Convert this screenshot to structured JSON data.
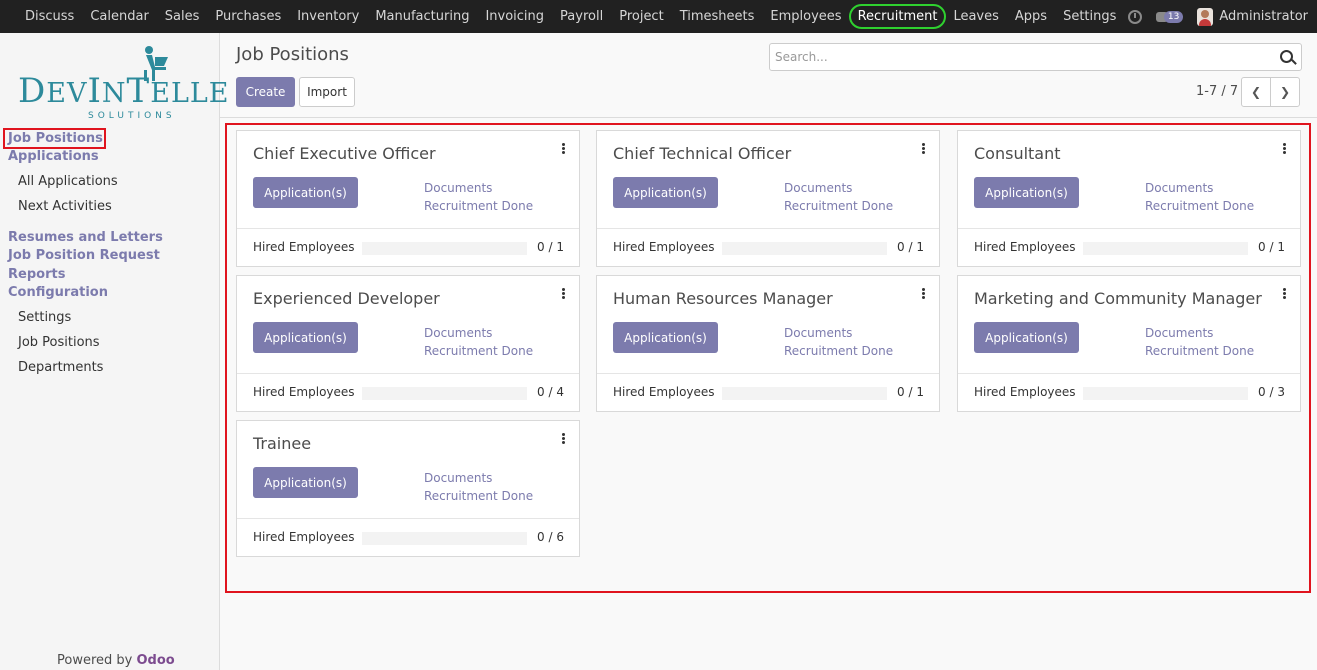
{
  "topbar": {
    "menu": [
      "Discuss",
      "Calendar",
      "Sales",
      "Purchases",
      "Inventory",
      "Manufacturing",
      "Invoicing",
      "Payroll",
      "Project",
      "Timesheets",
      "Employees",
      "Recruitment",
      "Leaves",
      "Apps",
      "Settings"
    ],
    "active": "Recruitment",
    "messages_count": "13",
    "user": "Administrator"
  },
  "sidebar": {
    "logo": {
      "text_big": "D",
      "text_rest": "EV",
      "text_big2": "I",
      "text_rest2": "N",
      "text3": "T",
      "text4": "ELLE",
      "sub": "SOLUTIONS"
    },
    "items": [
      {
        "label": "Job Positions",
        "type": "head"
      },
      {
        "label": "Applications",
        "type": "head"
      },
      {
        "label": "All Applications",
        "type": "sub"
      },
      {
        "label": "Next Activities",
        "type": "sub"
      },
      {
        "label": "Resumes and Letters",
        "type": "head"
      },
      {
        "label": "Job Position Request",
        "type": "head"
      },
      {
        "label": "Reports",
        "type": "head"
      },
      {
        "label": "Configuration",
        "type": "head"
      },
      {
        "label": "Settings",
        "type": "sub"
      },
      {
        "label": "Job Positions",
        "type": "sub"
      },
      {
        "label": "Departments",
        "type": "sub"
      }
    ],
    "powered_prefix": "Powered by ",
    "powered_brand": "Odoo"
  },
  "control": {
    "title": "Job Positions",
    "create_label": "Create",
    "import_label": "Import",
    "search_placeholder": "Search...",
    "pager": "1-7 / 7"
  },
  "cards": [
    {
      "title": "Chief Executive Officer",
      "button": "Application(s)",
      "link1": "Documents",
      "link2": "Recruitment Done",
      "footer_label": "Hired Employees",
      "hired": 0,
      "target": 1,
      "value": "0 / 1"
    },
    {
      "title": "Chief Technical Officer",
      "button": "Application(s)",
      "link1": "Documents",
      "link2": "Recruitment Done",
      "footer_label": "Hired Employees",
      "hired": 0,
      "target": 1,
      "value": "0 / 1"
    },
    {
      "title": "Consultant",
      "button": "Application(s)",
      "link1": "Documents",
      "link2": "Recruitment Done",
      "footer_label": "Hired Employees",
      "hired": 0,
      "target": 1,
      "value": "0 / 1"
    },
    {
      "title": "Experienced Developer",
      "button": "Application(s)",
      "link1": "Documents",
      "link2": "Recruitment Done",
      "footer_label": "Hired Employees",
      "hired": 0,
      "target": 4,
      "value": "0 / 4"
    },
    {
      "title": "Human Resources Manager",
      "button": "Application(s)",
      "link1": "Documents",
      "link2": "Recruitment Done",
      "footer_label": "Hired Employees",
      "hired": 0,
      "target": 1,
      "value": "0 / 1"
    },
    {
      "title": "Marketing and Community Manager",
      "button": "Application(s)",
      "link1": "Documents",
      "link2": "Recruitment Done",
      "footer_label": "Hired Employees",
      "hired": 0,
      "target": 3,
      "value": "0 / 3"
    },
    {
      "title": "Trainee",
      "button": "Application(s)",
      "link1": "Documents",
      "link2": "Recruitment Done",
      "footer_label": "Hired Employees",
      "hired": 0,
      "target": 6,
      "value": "0 / 6"
    }
  ],
  "colors": {
    "accent": "#7c7bad",
    "topbar": "#212121",
    "highlight_red": "#e0141e",
    "highlight_green": "#2fd12f"
  }
}
